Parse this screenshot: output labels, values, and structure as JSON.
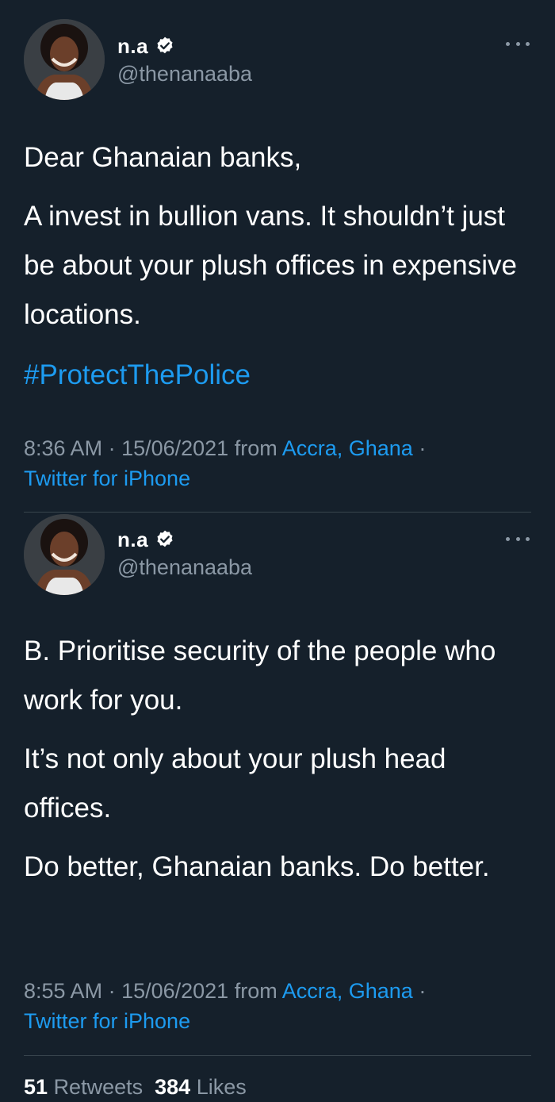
{
  "colors": {
    "background": "#15202b",
    "text_primary": "#ffffff",
    "text_secondary": "#8b98a5",
    "accent_link": "#1d9bf0",
    "divider": "#38444d"
  },
  "tweets": [
    {
      "author": {
        "display_name": "n.a",
        "handle": "@thenanaaba",
        "verified_icon": "verified-badge-icon",
        "avatar_icon": "profile-avatar"
      },
      "paragraphs": [
        "Dear Ghanaian banks,",
        "A invest in bullion vans. It shouldn’t just be about your plush offices in expensive locations."
      ],
      "hashtag": "#ProtectThePolice",
      "meta": {
        "time": "8:36 AM",
        "sep1": " · ",
        "date": "15/06/2021",
        "from_label": " from ",
        "location": "Accra, Ghana",
        "sep2": " ·",
        "source": "Twitter for iPhone"
      }
    },
    {
      "author": {
        "display_name": "n.a",
        "handle": "@thenanaaba",
        "verified_icon": "verified-badge-icon",
        "avatar_icon": "profile-avatar"
      },
      "paragraphs": [
        "B. Prioritise security of the people who work for you.",
        "It’s not only about your plush head offices.",
        "Do better, Ghanaian banks. Do better."
      ],
      "meta": {
        "time": "8:55 AM",
        "sep1": " · ",
        "date": "15/06/2021",
        "from_label": " from ",
        "location": "Accra, Ghana",
        "sep2": " ·",
        "source": "Twitter for iPhone"
      },
      "stats": {
        "retweets_count": "51",
        "retweets_label": "Retweets",
        "likes_count": "384",
        "likes_label": "Likes"
      }
    }
  ]
}
